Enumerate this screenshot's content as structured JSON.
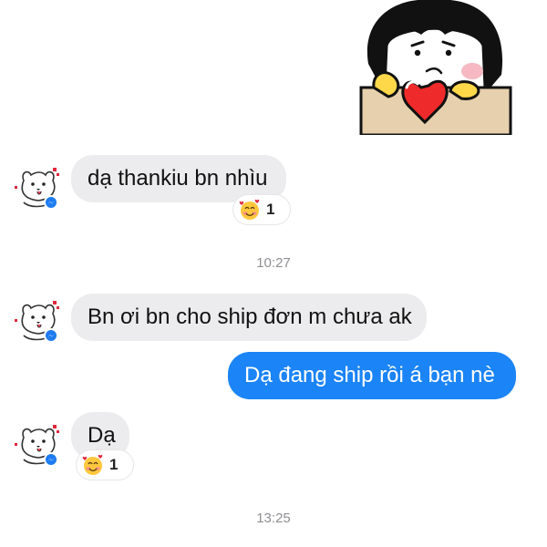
{
  "messages": [
    {
      "text": "dạ thankiu bn nhìu",
      "reaction": {
        "emoji": "smiling-face-with-hearts",
        "count": "1"
      }
    },
    {
      "text": "Bn ơi bn cho ship đơn m chưa ak"
    },
    {
      "text": "Dạ đang ship rồi á bạn nè"
    },
    {
      "text": "Dạ",
      "reaction": {
        "emoji": "smiling-face-with-hearts",
        "count": "1"
      }
    }
  ],
  "timestamps": [
    "10:27",
    "13:25"
  ],
  "colors": {
    "incoming_bubble": "#ececee",
    "outgoing_bubble": "#1b84f6",
    "timestamp_text": "#8e8e93",
    "messenger_badge": "#1e7cf2"
  },
  "icons": {
    "sticker": "girl-holding-heart-sticker",
    "avatar": "bear-avatar",
    "badge": "messenger-icon",
    "reaction": "smiling-face-with-hearts-icon"
  }
}
